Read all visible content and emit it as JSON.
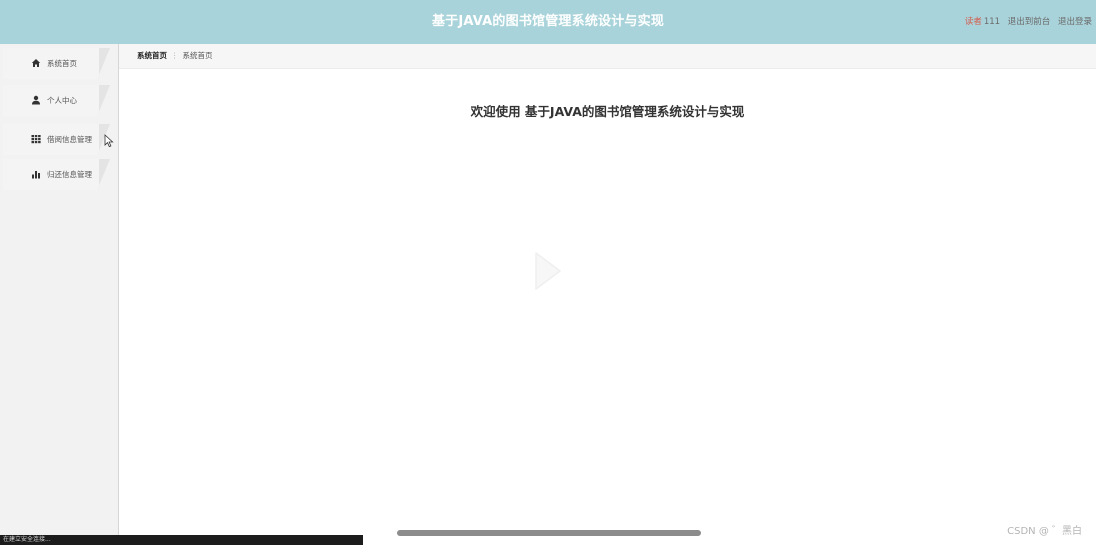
{
  "header": {
    "title": "基于JAVA的图书馆管理系统设计与实现",
    "user_role": "读者",
    "user_name": "111",
    "back_to_front_label": "退出到前台",
    "logout_label": "退出登录"
  },
  "sidebar": {
    "items": [
      {
        "label": "系统首页",
        "icon": "home-icon"
      },
      {
        "label": "个人中心",
        "icon": "user-icon"
      },
      {
        "label": "借阅信息管理",
        "icon": "grid-icon"
      },
      {
        "label": "归还信息管理",
        "icon": "bar-chart-icon"
      }
    ]
  },
  "breadcrumb": {
    "home": "系统首页",
    "separator": "⋮",
    "current": "系统首页"
  },
  "main": {
    "welcome": "欢迎使用 基于JAVA的图书馆管理系统设计与实现"
  },
  "status_bar": {
    "text": "在建立安全连接..."
  },
  "watermark": "CSDN @ ゛黑白",
  "colors": {
    "header_bg": "#a9d3da",
    "sidebar_bg": "#f2f2f2",
    "status_bar_bg": "#1c1c1c"
  }
}
